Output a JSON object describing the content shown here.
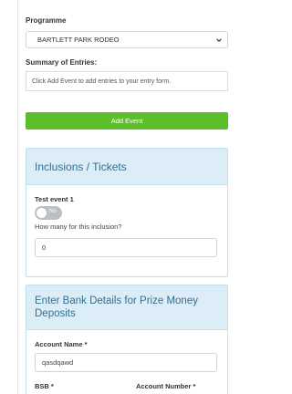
{
  "form": {
    "programme_label": "Programme",
    "programme_value": "BARTLETT PARK RODEO",
    "summary_label": "Summary of Entries:",
    "summary_text": "Click Add Event to add entries to your entry form.",
    "add_event_label": "Add Event"
  },
  "inclusions": {
    "title": "Inclusions / Tickets",
    "event_name": "Test event 1",
    "toggle_text": "No",
    "question": "How many for this inclusion?",
    "quantity_value": "0"
  },
  "bank": {
    "title": "Enter Bank Details for Prize Money Deposits",
    "account_name_label": "Account Name *",
    "account_name_value": "qasdqawd",
    "bsb_label": "BSB *",
    "account_number_label": "Account Number *"
  },
  "colors": {
    "accent_green": "#5cbf2a",
    "panel_header_bg": "#dcedf7",
    "panel_title": "#31708f"
  }
}
